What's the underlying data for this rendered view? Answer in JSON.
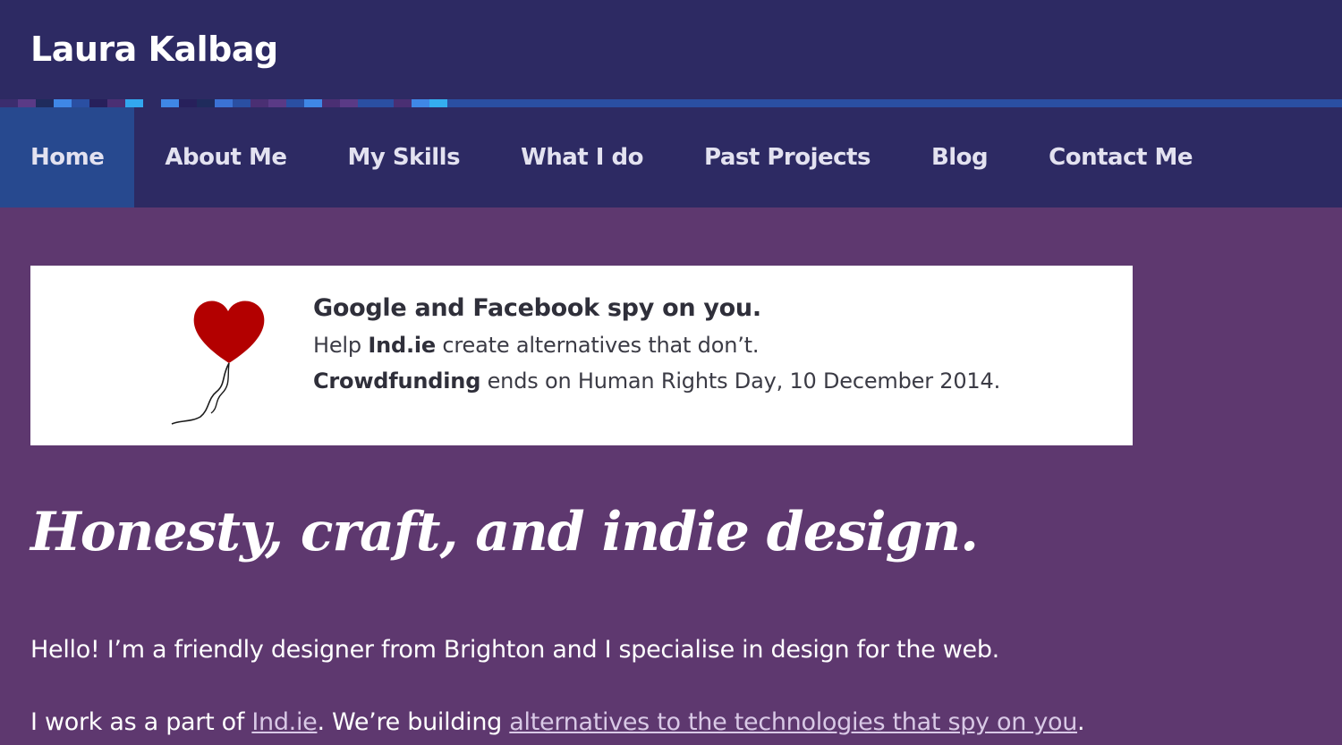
{
  "site": {
    "title": "Laura Kalbag"
  },
  "stripe_colors": [
    "#3b2d6e",
    "#5a3a86",
    "#1f2b5c",
    "#3f87e6",
    "#2a4fa2",
    "#27205b",
    "#4a2f73",
    "#32a7ef",
    "#2d2a63",
    "#3f87e6",
    "#27205b",
    "#1f2b5c",
    "#3b72d4",
    "#2a4fa2",
    "#4a2f73",
    "#5a3a86",
    "#2a4fa2",
    "#3f87e6",
    "#4a2f73",
    "#5a3a86",
    "#2a4fa2",
    "#2a4fa2",
    "#4a2f73",
    "#3f87e6",
    "#34aef0"
  ],
  "nav": {
    "items": [
      {
        "label": "Home",
        "active": true
      },
      {
        "label": "About Me"
      },
      {
        "label": "My Skills"
      },
      {
        "label": "What I do"
      },
      {
        "label": "Past Projects"
      },
      {
        "label": "Blog"
      },
      {
        "label": "Contact Me"
      }
    ]
  },
  "banner": {
    "icon": "heart-balloon-icon",
    "headline": "Google and Facebook spy on you.",
    "line1_prefix": "Help ",
    "line1_bold": "Ind.ie",
    "line1_suffix": " create alternatives that don’t.",
    "line2_bold": "Crowdfunding",
    "line2_suffix": " ends on Human Rights Day, 10 December 2014."
  },
  "main": {
    "tagline": "Honesty, craft, and indie design.",
    "intro": "Hello! I’m a friendly designer from Brighton and I specialise in design for the web.",
    "work_prefix": "I work as a part of ",
    "work_link1": "Ind.ie",
    "work_middle": ". We’re building ",
    "work_link2": "alternatives to the technologies that spy on you",
    "work_suffix": "."
  },
  "colors": {
    "header_bg": "#2d2a63",
    "nav_active_bg": "#27498f",
    "page_bg": "#5e386f",
    "heart": "#b30000"
  }
}
